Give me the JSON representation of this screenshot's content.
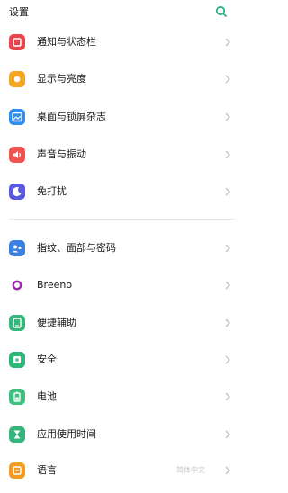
{
  "header": {
    "title": "设置",
    "search_icon": "search-icon",
    "accent": "#2fb38a"
  },
  "groups": [
    {
      "items": [
        {
          "label": "通知与状态栏",
          "icon": "notification-icon",
          "color": "#e8464f"
        },
        {
          "label": "显示与亮度",
          "icon": "brightness-icon",
          "color": "#f5a623"
        },
        {
          "label": "桌面与锁屏杂志",
          "icon": "wallpaper-icon",
          "color": "#2f8ff0"
        },
        {
          "label": "声音与振动",
          "icon": "speaker-icon",
          "color": "#ef5350"
        },
        {
          "label": "免打扰",
          "icon": "moon-icon",
          "color": "#5c5ae0"
        }
      ]
    },
    {
      "items": [
        {
          "label": "指纹、面部与密码",
          "icon": "fingerprint-icon",
          "color": "#3b7fe0"
        },
        {
          "label": "Breeno",
          "icon": "breeno-icon",
          "color": "#9c27b0"
        },
        {
          "label": "便捷辅助",
          "icon": "assist-icon",
          "color": "#34b77a"
        },
        {
          "label": "安全",
          "icon": "shield-icon",
          "color": "#2eb87a"
        },
        {
          "label": "电池",
          "icon": "battery-icon",
          "color": "#3cc17e"
        },
        {
          "label": "应用使用时间",
          "icon": "hourglass-icon",
          "color": "#33b57c"
        },
        {
          "label": "语言",
          "icon": "language-icon",
          "color": "#f29c1f"
        }
      ]
    }
  ],
  "watermark": "简体中文"
}
